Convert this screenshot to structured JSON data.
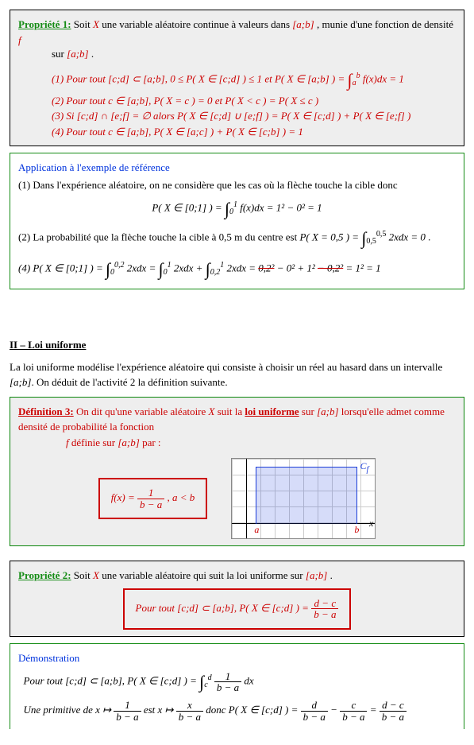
{
  "prop1": {
    "title": "Propriété 1:",
    "intro_a": "Soit ",
    "intro_b": " une variable aléatoire continue à valeurs dans ",
    "intro_c": ", munie d'une fonction de densité ",
    "intro_d": "sur ",
    "X": "X",
    "ab": "[a;b]",
    "f": "f",
    "l1_a": "(1) Pour tout ",
    "l1_b": "[c;d] ⊂ [a;b]",
    "l1_c": ", 0 ≤ P( X ∈ [c;d] ) ≤ 1",
    "l1_d": "  et  ",
    "l1_e": "P( X ∈ [a;b] ) = ",
    "l1_int_low": "a",
    "l1_int_up": "b",
    "l1_f": " f(x)dx = 1",
    "l2": "(2) Pour tout c ∈ [a;b], P( X = c ) = 0  et  P( X < c ) = P( X ≤ c )",
    "l3": "(3) Si [c;d] ∩ [e;f] = ∅  alors  P( X ∈ [c;d] ∪ [e;f] ) = P( X ∈ [c;d] ) + P( X ∈ [e;f] )",
    "l4": "(4) Pour tout c ∈ [a;b], P( X ∈ [a;c] ) + P( X ∈ [c;b] ) = 1"
  },
  "app": {
    "title": "Application à l'exemple de référence",
    "l1": "(1) Dans l'expérience aléatoire, on ne considère que les cas où la flèche touche la cible donc",
    "f1_a": "P( X ∈ [0;1] ) = ",
    "f1_low": "0",
    "f1_up": "1",
    "f1_b": " f(x)dx = 1² − 0² = 1",
    "l2_a": "(2) La probabilité que la flèche touche la cible à 0,5 m du centre est ",
    "l2_b": "P( X = 0,5 ) = ",
    "l2_low": "0,5",
    "l2_up": "0,5",
    "l2_c": " 2xdx = 0",
    "l4_a": "(4) P( X ∈ [0;1] ) = ",
    "l4_i1_low": "0",
    "l4_i1_up": "0,2",
    "l4_b": " 2xdx = ",
    "l4_i2_low": "0",
    "l4_i2_up": "1",
    "l4_c": " 2xdx + ",
    "l4_i3_low": "0,2",
    "l4_i3_up": "1",
    "l4_d": " 2xdx = ",
    "l4_e": "0,2²",
    "l4_f": " − 0² + 1² ",
    "l4_g": "− 0,2²",
    "l4_h": " = 1² = 1"
  },
  "section2": "II – Loi uniforme",
  "para2_a": "La loi uniforme modélise l'expérience aléatoire qui consiste à choisir un réel au hasard dans un intervalle ",
  "para2_b": "[a;b]",
  "para2_c": ". On déduit de l'activité 2 la définition suivante.",
  "def3": {
    "title": "Définition 3:",
    "t1": " On dit qu'une variable aléatoire ",
    "X": "X",
    "t2": " suit la ",
    "loi": "loi uniforme",
    "t3": " sur ",
    "ab": "[a;b]",
    "t4": " lorsqu'elle admet comme densité de probabilité la fonction ",
    "f": "f",
    "t5": " définie sur ",
    "t6": " par :",
    "formula_lhs": "f(x) = ",
    "formula_num": "1",
    "formula_den": "b − a",
    "formula_cond": " ,  a < b"
  },
  "chart_data": {
    "type": "area",
    "title": "",
    "xlabel": "x",
    "ylabel": "",
    "x": [
      "a",
      "b"
    ],
    "series": [
      {
        "name": "C_f",
        "values": [
          "1/(b−a)",
          "1/(b−a)"
        ]
      }
    ],
    "ylim": [
      0,
      "1/(b−a)"
    ],
    "annotations": [
      "a",
      "b",
      "C_f",
      "x"
    ]
  },
  "chartlabels": {
    "a": "a",
    "b": "b",
    "cf": "C",
    "cfsub": "f",
    "x": "x"
  },
  "prop2": {
    "title": "Propriété 2:",
    "t1": " Soit ",
    "X": "X",
    "t2": " une variable aléatoire qui suit la loi uniforme sur ",
    "ab": "[a;b]",
    "r1": "Pour tout ",
    "r2": "[c;d] ⊂ [a;b]",
    "r3": ",  P( X ∈ [c;d] ) = ",
    "r_num": "d − c",
    "r_den": "b − a"
  },
  "demo": {
    "title": "Démonstration",
    "l1_a": "Pour tout ",
    "l1_b": "[c;d] ⊂ [a;b]",
    "l1_c": ",  P( X ∈ [c;d] ) = ",
    "l1_low": "c",
    "l1_up": "d",
    "l1_num": "1",
    "l1_den": "b − a",
    "l1_d": " dx",
    "l2_a": "Une primitive de ",
    "l2_b": "x ↦ ",
    "l2_num1": "1",
    "l2_den1": "b − a",
    "l2_c": " est ",
    "l2_d": "x ↦ ",
    "l2_num2": "x",
    "l2_den2": "b − a",
    "l2_e": " donc ",
    "l2_f": "P( X ∈ [c;d] ) = ",
    "l2_numA": "d",
    "l2_denA": "b − a",
    "l2_g": " − ",
    "l2_numB": "c",
    "l2_denB": "b − a",
    "l2_h": " = ",
    "l2_numC": "d − c",
    "l2_denC": "b − a"
  }
}
